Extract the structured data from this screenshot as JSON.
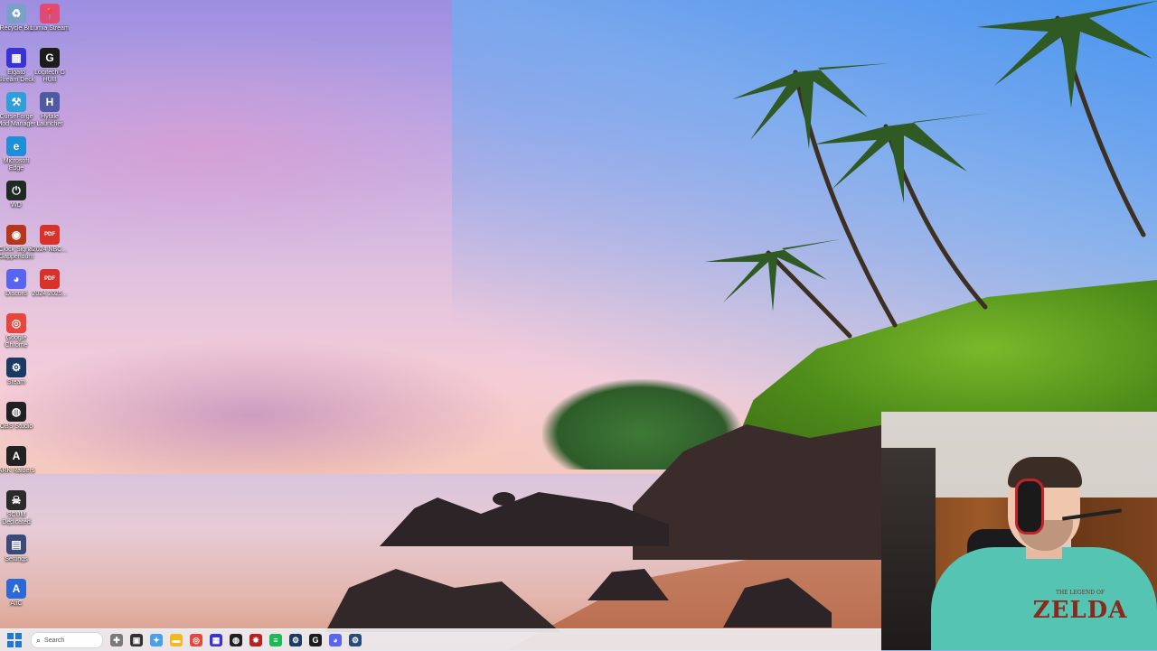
{
  "desktop": {
    "icons": [
      {
        "label": "Recycle Bin",
        "icon": "recycle-bin-icon",
        "glyph": "♻",
        "color": "#7aa0c8"
      },
      {
        "label": "Lumia Stream",
        "icon": "lumia-stream-icon",
        "glyph": "📍",
        "color": "#e04a78"
      },
      {
        "label": "Elgato Stream Deck",
        "icon": "stream-deck-icon",
        "glyph": "▦",
        "color": "#3b32d6"
      },
      {
        "label": "Logitech G HUB",
        "icon": "logitech-ghub-icon",
        "glyph": "G",
        "color": "#1c1c1c"
      },
      {
        "label": "CurseForge Mod Manager",
        "icon": "curseforge-icon",
        "glyph": "⚒",
        "color": "#2f9fd8"
      },
      {
        "label": "Hytale Launcher",
        "icon": "hytale-icon",
        "glyph": "H",
        "color": "#4f5aa0"
      },
      {
        "label": "Microsoft Edge",
        "icon": "edge-icon",
        "glyph": "e",
        "color": "#1c8fd6"
      },
      {
        "label": "WD",
        "icon": "power-icon",
        "glyph": "⏻",
        "color": "#1f2a24"
      },
      {
        "label": "Clock Signal Gappendum",
        "icon": "clock-signal-icon",
        "glyph": "◉",
        "color": "#b5361a"
      },
      {
        "label": "2024 NBC...",
        "icon": "pdf-icon",
        "glyph": "PDF",
        "color": "#d8322a"
      },
      {
        "label": "Discord",
        "icon": "discord-icon",
        "glyph": "◕",
        "color": "#5865f2"
      },
      {
        "label": "2024 2025...",
        "icon": "pdf-icon",
        "glyph": "PDF",
        "color": "#d8322a"
      },
      {
        "label": "Google Chrome",
        "icon": "chrome-icon",
        "glyph": "◎",
        "color": "#e8453c"
      },
      {
        "label": "Steam",
        "icon": "steam-icon",
        "glyph": "⚙",
        "color": "#1b3a63"
      },
      {
        "label": "OBS Studio",
        "icon": "obs-icon",
        "glyph": "◍",
        "color": "#202024"
      },
      {
        "label": "ARK Raiders",
        "icon": "arc-raiders-icon",
        "glyph": "A",
        "color": "#222"
      },
      {
        "label": "SCUM Dedicated Server",
        "icon": "scum-icon",
        "glyph": "☠",
        "color": "#2a2a2a"
      },
      {
        "label": "Settings",
        "icon": "settings-app-icon",
        "glyph": "▤",
        "color": "#3a4a7a"
      },
      {
        "label": "AltC",
        "icon": "alt-app-icon",
        "glyph": "A",
        "color": "#2a6ad8"
      }
    ]
  },
  "taskbar": {
    "search_placeholder": "Search",
    "pinned": [
      {
        "icon": "widgets-icon",
        "glyph": "✚",
        "color": "#7a7a7a"
      },
      {
        "icon": "task-view-icon",
        "glyph": "▣",
        "color": "#333"
      },
      {
        "icon": "copilot-icon",
        "glyph": "✦",
        "color": "#4aa0e8"
      },
      {
        "icon": "file-explorer-icon",
        "glyph": "▬",
        "color": "#f2b824"
      },
      {
        "icon": "chrome-icon",
        "glyph": "◎",
        "color": "#e8453c"
      },
      {
        "icon": "stream-deck-icon",
        "glyph": "▦",
        "color": "#3b32d6"
      },
      {
        "icon": "obs-icon",
        "glyph": "◍",
        "color": "#202024"
      },
      {
        "icon": "scum-icon",
        "glyph": "✸",
        "color": "#b92020"
      },
      {
        "icon": "spotify-icon",
        "glyph": "≡",
        "color": "#1db954"
      },
      {
        "icon": "steam-icon",
        "glyph": "⚙",
        "color": "#1b3a63"
      },
      {
        "icon": "logitech-ghub-icon",
        "glyph": "G",
        "color": "#1c1c1c"
      },
      {
        "icon": "discord-icon",
        "glyph": "◕",
        "color": "#5865f2"
      },
      {
        "icon": "steam-icon",
        "glyph": "⚙",
        "color": "#2a4a7a"
      }
    ]
  },
  "webcam": {
    "shirt_title": "ZELDA",
    "shirt_subtitle": "THE LEGEND OF"
  }
}
